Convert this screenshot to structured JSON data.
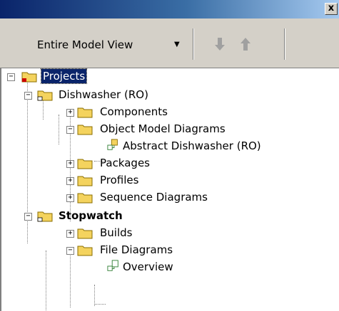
{
  "window": {
    "close_glyph": "x"
  },
  "toolbar": {
    "view_label": "Entire Model View",
    "dropdown_glyph": "▼",
    "back_glyph": "🡇",
    "up_glyph": "🡅"
  },
  "tree": {
    "projects": "Projects",
    "dishwasher": "Dishwasher (RO)",
    "components": "Components",
    "omd": "Object Model Diagrams",
    "abstract": "Abstract Dishwasher (RO)",
    "packages": "Packages",
    "profiles": "Profiles",
    "sequence": "Sequence Diagrams",
    "stopwatch": "Stopwatch",
    "builds": "Builds",
    "file_diagrams": "File Diagrams",
    "overview": "Overview"
  },
  "glyphs": {
    "plus": "+",
    "minus": "−"
  }
}
